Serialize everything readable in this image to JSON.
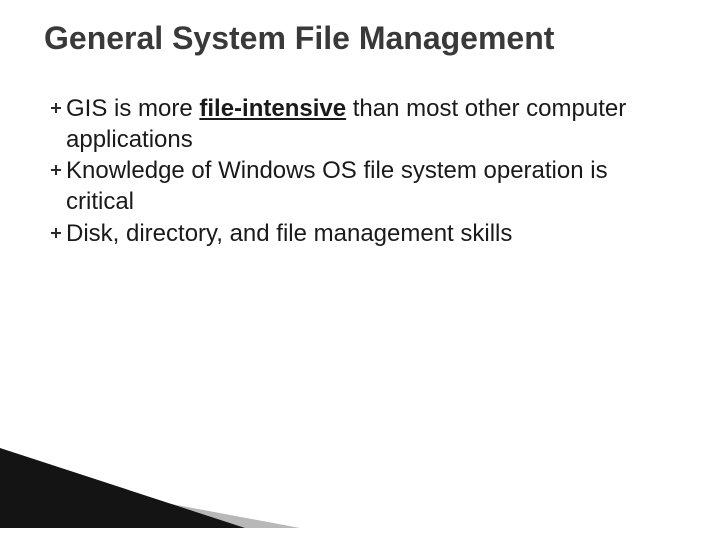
{
  "title": "General System File Management",
  "bullets": [
    {
      "pre": "GIS is more ",
      "emph": "file-intensive",
      "post": " than most other computer applications"
    },
    {
      "pre": "Knowledge of Windows OS file system operation is critical",
      "emph": "",
      "post": ""
    },
    {
      "pre": "Disk, directory, and file management skills",
      "emph": "",
      "post": ""
    }
  ],
  "colors": {
    "title": "#393939",
    "body": "#1a1a1a",
    "wedge_dark": "#141414",
    "wedge_grey": "#b8b8b8"
  }
}
